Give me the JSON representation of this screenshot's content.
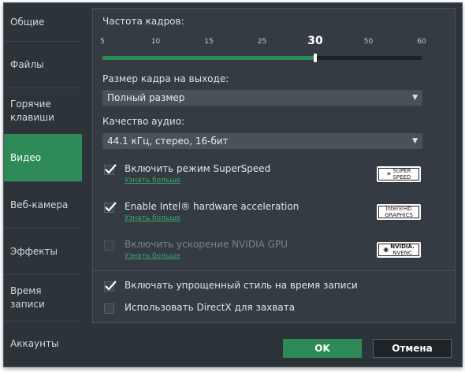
{
  "sidebar": {
    "items": [
      {
        "label": "Общие"
      },
      {
        "label": "Файлы"
      },
      {
        "label": "Горячие\nклавиши"
      },
      {
        "label": "Видео"
      },
      {
        "label": "Веб-камера"
      },
      {
        "label": "Эффекты"
      },
      {
        "label": "Время\nзаписи"
      },
      {
        "label": "Аккаунты"
      }
    ],
    "active_index": 3
  },
  "video": {
    "frame_rate": {
      "label": "Частота кадров:",
      "ticks": [
        "5",
        "10",
        "15",
        "25",
        "30",
        "50",
        "60"
      ],
      "selected": "30",
      "value_fraction": 0.667
    },
    "frame_size": {
      "label": "Размер кадра на выходе:",
      "value": "Полный размер"
    },
    "audio_quality": {
      "label": "Качество аудио:",
      "value": "44.1 кГц, стерео, 16-бит"
    },
    "superspeed": {
      "label": "Включить режим SuperSpeed",
      "checked": true,
      "more": "Узнать больше",
      "badge_line1": "SUPER",
      "badge_line2": "SPEED"
    },
    "intel_hw": {
      "label": "Enable Intel® hardware acceleration",
      "checked": true,
      "more": "Узнать больше",
      "badge_line1": "Intel®HD",
      "badge_line2": "GRAPHICS"
    },
    "nvidia": {
      "label": "Включить ускорение NVIDIA GPU",
      "checked": false,
      "disabled": true,
      "more": "Узнать больше",
      "badge_line1": "NVIDIA.",
      "badge_line2": "NVENC"
    },
    "simplified_style": {
      "label": "Включать упрощенный стиль на время записи",
      "checked": true
    },
    "directx": {
      "label": "Использовать DirectX для захвата",
      "checked": false
    }
  },
  "footer": {
    "ok_label": "OK",
    "cancel_label": "Отмена"
  },
  "colors": {
    "accent": "#2e8a56",
    "background": "#2c3339",
    "panel": "#343b42"
  }
}
